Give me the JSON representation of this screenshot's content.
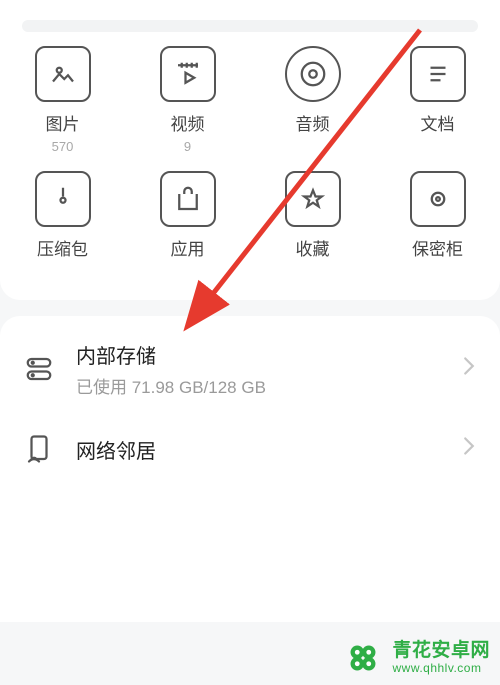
{
  "search": {
    "placeholder": ""
  },
  "categories": {
    "row1": [
      {
        "label": "图片",
        "count": "570",
        "icon": "image-icon"
      },
      {
        "label": "视频",
        "count": "9",
        "icon": "video-icon"
      },
      {
        "label": "音频",
        "count": "",
        "icon": "audio-icon"
      },
      {
        "label": "文档",
        "count": "",
        "icon": "document-icon"
      }
    ],
    "row2": [
      {
        "label": "压缩包",
        "count": "",
        "icon": "archive-icon"
      },
      {
        "label": "应用",
        "count": "",
        "icon": "app-icon"
      },
      {
        "label": "收藏",
        "count": "",
        "icon": "favorite-icon"
      },
      {
        "label": "保密柜",
        "count": "",
        "icon": "safe-icon"
      }
    ]
  },
  "storage": {
    "title": "内部存储",
    "sub": "已使用 71.98 GB/128 GB"
  },
  "network": {
    "title": "网络邻居"
  },
  "watermark": {
    "title": "青花安卓网",
    "url": "www.qhhlv.com"
  }
}
